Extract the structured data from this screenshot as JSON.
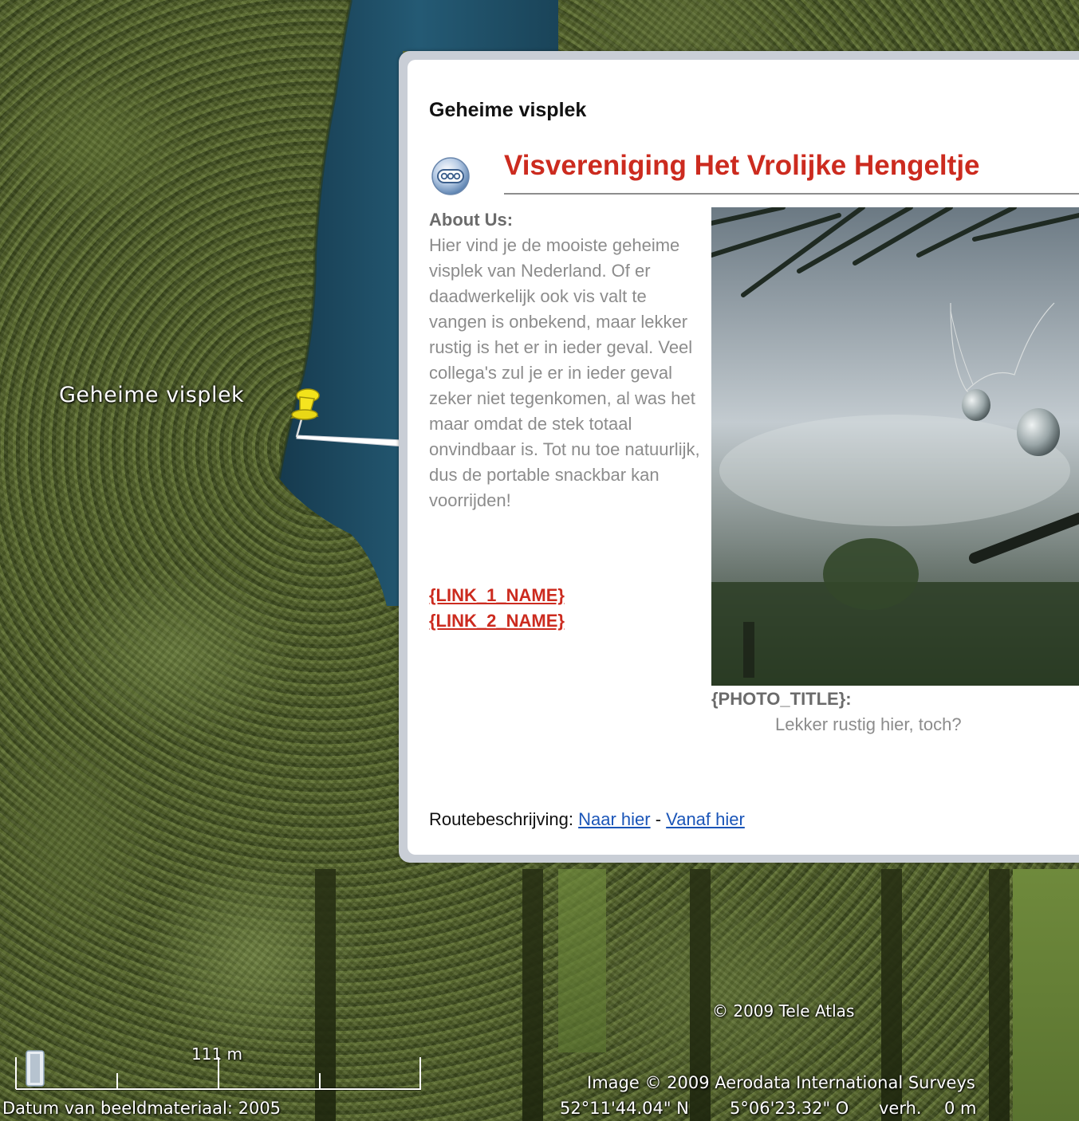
{
  "map": {
    "placemark_label": "Geheime visplek",
    "scale_label": "111 m",
    "copyright_teleatlas": "© 2009 Tele Atlas",
    "copyright_aerodata": "Image © 2009 Aerodata International Surveys",
    "capture_date": "Datum van beeldmateriaal: 2005",
    "latitude": "52°11'44.04\" N",
    "longitude": "5°06'23.32\" O",
    "elevation_label": "verh.",
    "elevation_value": "0 m",
    "colors": {
      "pushpin": "#f2e21a",
      "water": "#1f4b63"
    }
  },
  "balloon": {
    "title": "Geheime visplek",
    "org_title": "Visvereniging Het Vrolijke Hengeltje",
    "org_logo_icon": "chat-bubble-icon",
    "about_heading": "About Us:",
    "about_body": "Hier vind je de mooiste geheime visplek van Nederland. Of er daadwerkelijk ook vis valt te vangen is onbekend, maar lekker rustig is het er in ieder geval. Veel collega's zul je er in ieder geval zeker niet tegenkomen, al was het maar omdat de stek totaal onvindbaar is. Tot nu toe natuurlijk, dus de portable snackbar kan voorrijden!",
    "link_1": "{LINK_1_NAME}",
    "link_2": "{LINK_2_NAME}",
    "photo_title": "{PHOTO_TITLE}:",
    "photo_caption": "Lekker rustig hier, toch?",
    "route_label": "Routebeschrijving:",
    "route_to": "Naar hier",
    "route_separator": "-",
    "route_from": "Vanaf hier",
    "colors": {
      "accent": "#cc2b1f",
      "link": "#1a55b8"
    }
  }
}
